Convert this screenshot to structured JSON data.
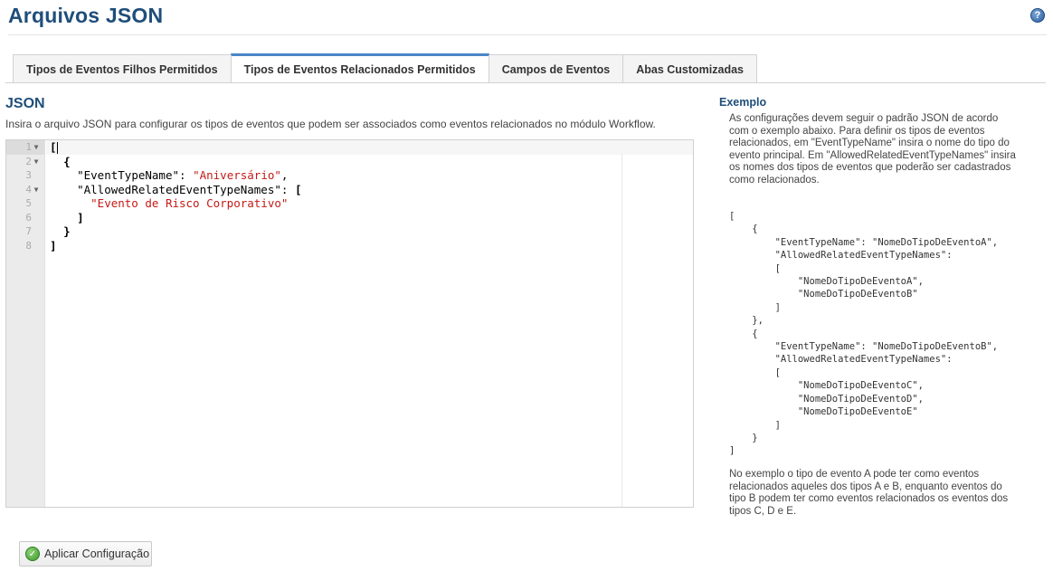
{
  "page": {
    "title": "Arquivos JSON",
    "help_icon": "help-icon",
    "accent_color": "#1f4e79"
  },
  "tabs": [
    {
      "label": "Tipos de Eventos Filhos Permitidos",
      "active": false
    },
    {
      "label": "Tipos de Eventos Relacionados Permitidos",
      "active": true
    },
    {
      "label": "Campos de Eventos",
      "active": false
    },
    {
      "label": "Abas Customizadas",
      "active": false
    }
  ],
  "json_section": {
    "title": "JSON",
    "description": "Insira o arquivo JSON para configurar os tipos de eventos que podem ser associados como eventos relacionados no módulo Workflow.",
    "editor": {
      "line_numbers": [
        "1",
        "2",
        "3",
        "4",
        "5",
        "6",
        "7",
        "8"
      ],
      "lines": {
        "l1": "[",
        "l2": "{",
        "l3_key": "\"EventTypeName\"",
        "l3_sep": ": ",
        "l3_val": "\"Aniversário\"",
        "l3_end": ",",
        "l4_key": "\"AllowedRelatedEventTypeNames\"",
        "l4_sep": ": ",
        "l4_brk": "[",
        "l5_val": "\"Evento de Risco Corporativo\"",
        "l6": "]",
        "l7": "}",
        "l8": "]"
      }
    }
  },
  "example": {
    "title": "Exemplo",
    "intro": "As configurações devem seguir o padrão JSON de acordo com o exemplo abaixo. Para definir os tipos de eventos relacionados, em \"EventTypeName\" insira o nome do tipo do evento principal. Em \"AllowedRelatedEventTypeNames\" insira os nomes dos tipos de eventos que poderão ser cadastrados como relacionados.",
    "code": "[\n    {\n        \"EventTypeName\": \"NomeDoTipoDeEventoA\",\n        \"AllowedRelatedEventTypeNames\":\n        [\n            \"NomeDoTipoDeEventoA\",\n            \"NomeDoTipoDeEventoB\"\n        ]\n    },\n    {\n        \"EventTypeName\": \"NomeDoTipoDeEventoB\",\n        \"AllowedRelatedEventTypeNames\":\n        [\n            \"NomeDoTipoDeEventoC\",\n            \"NomeDoTipoDeEventoD\",\n            \"NomeDoTipoDeEventoE\"\n        ]\n    }\n]",
    "footer": "No exemplo o tipo de evento A pode ter como eventos relacionados aqueles dos tipos A e B, enquanto eventos do tipo B podem ter como eventos relacionados os eventos dos tipos C, D e E."
  },
  "actions": {
    "apply_label": "Aplicar Configuração",
    "apply_icon": "checkmark-icon"
  }
}
